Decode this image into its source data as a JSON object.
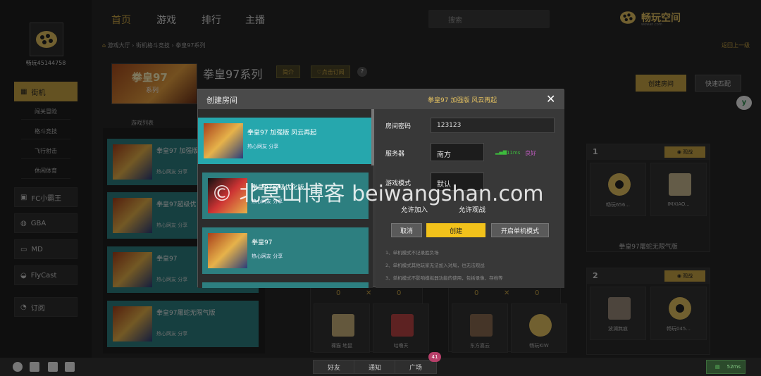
{
  "user": {
    "name": "畅玩45144758"
  },
  "nav": {
    "items": [
      "首页",
      "游戏",
      "排行",
      "主播"
    ],
    "search_placeholder": "搜索"
  },
  "logo": {
    "text": "畅玩空间",
    "sub": "wowan.com"
  },
  "breadcrumb": {
    "home": "游戏大厅",
    "mid": "街机格斗竞技",
    "current": "拳皇97系列"
  },
  "back_label": "返回上一级",
  "sidebar": {
    "arcade": "街机",
    "arcade_sub": [
      "闯关冒险",
      "格斗竞技",
      "飞行射击",
      "休闲体育"
    ],
    "platforms": [
      "FC小霸王",
      "GBA",
      "MD",
      "FlyCast"
    ],
    "subscribe": "订阅"
  },
  "game": {
    "title": "拳皇97系列",
    "intro_label": "简介",
    "subscribe_label": "♡点击订阅",
    "help": "?",
    "thumb_text": "拳皇97",
    "thumb_sub": "系列"
  },
  "actions": {
    "create_room": "创建房间",
    "quick_match": "快速匹配"
  },
  "list_label": "游戏列表",
  "bg_list": [
    {
      "title": "拳皇97 加强版",
      "sub": "热心网友  分享"
    },
    {
      "title": "拳皇97超级优",
      "sub": "热心网友  分享"
    },
    {
      "title": "拳皇97",
      "sub": "热心网友  分享"
    },
    {
      "title": "拳皇97屠蛇无限气版",
      "sub": "热心网友  分享"
    }
  ],
  "rooms": [
    {
      "num": "1",
      "watch": "观战",
      "p1": "畅玩656...",
      "p2": "IMXIAO...",
      "footer": "拳皇97屠蛇无限气版"
    },
    {
      "num": "2",
      "watch": "观战",
      "p1": "波澜無痕",
      "p2": "畅玩045..."
    }
  ],
  "center_rooms": {
    "scoreL": "0",
    "scoreR": "0",
    "vs": "✕",
    "players": [
      "裸猫 地鼠",
      "咕噜天",
      "东方嘉云",
      "畅玩KIW"
    ]
  },
  "modal": {
    "title": "创建房间",
    "game": "拳皇97 加强版 风云再起",
    "close": "✕",
    "list": [
      {
        "title": "拳皇97 加强版 风云再起",
        "sub": "热心网友  分享"
      },
      {
        "title": "拳皇97超级优化版",
        "sub": "热心网友  分享"
      },
      {
        "title": "拳皇97",
        "sub": "热心网友  分享"
      }
    ],
    "password_label": "房间密码",
    "password_value": "123123",
    "server_label": "服务器",
    "server_value": "南方",
    "ping": "11ms",
    "ping_status": "良好",
    "mode_label": "游戏模式",
    "mode_value": "默认",
    "allow_join": "允许加入",
    "allow_watch": "允许观战",
    "cancel": "取消",
    "create": "创建",
    "single": "开启单机模式",
    "notes": [
      "1、单机模式不记录胜负场",
      "2、单机模式其他玩家无法加入对局，也无法观战",
      "3、单机模式不影响模拟器功能的使用，包括录像、存档等"
    ]
  },
  "watermark": "© 北冥山博客 beiwangshan.com",
  "bottom": {
    "friends": "好友",
    "notify": "通知",
    "square": "广场",
    "badge": "41",
    "net": "52ms"
  },
  "colors": {
    "accent": "#c9a445",
    "teal": "#2d7f80",
    "teal_selected": "#26a7ad",
    "ping_green": "#3dbb3d",
    "ping_status": "#c05ac0"
  }
}
